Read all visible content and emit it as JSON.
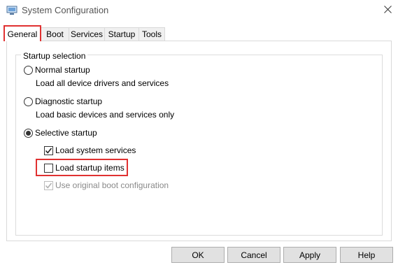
{
  "window": {
    "title": "System Configuration"
  },
  "tabs": [
    {
      "label": "General",
      "active": true
    },
    {
      "label": "Boot"
    },
    {
      "label": "Services"
    },
    {
      "label": "Startup"
    },
    {
      "label": "Tools"
    }
  ],
  "startup_selection": {
    "legend": "Startup selection",
    "options": [
      {
        "label": "Normal startup",
        "description": "Load all device drivers and services",
        "selected": false
      },
      {
        "label": "Diagnostic startup",
        "description": "Load basic devices and services only",
        "selected": false
      },
      {
        "label": "Selective startup",
        "selected": true
      }
    ],
    "selective_items": [
      {
        "label": "Load system services",
        "checked": true,
        "enabled": true
      },
      {
        "label": "Load startup items",
        "checked": false,
        "enabled": true
      },
      {
        "label": "Use original boot configuration",
        "checked": true,
        "enabled": false
      }
    ]
  },
  "buttons": {
    "ok": "OK",
    "cancel": "Cancel",
    "apply": "Apply",
    "help": "Help"
  },
  "colors": {
    "highlight": "#e03131",
    "disabled_text": "#8a8a8a",
    "button_face": "#e1e1e1"
  }
}
